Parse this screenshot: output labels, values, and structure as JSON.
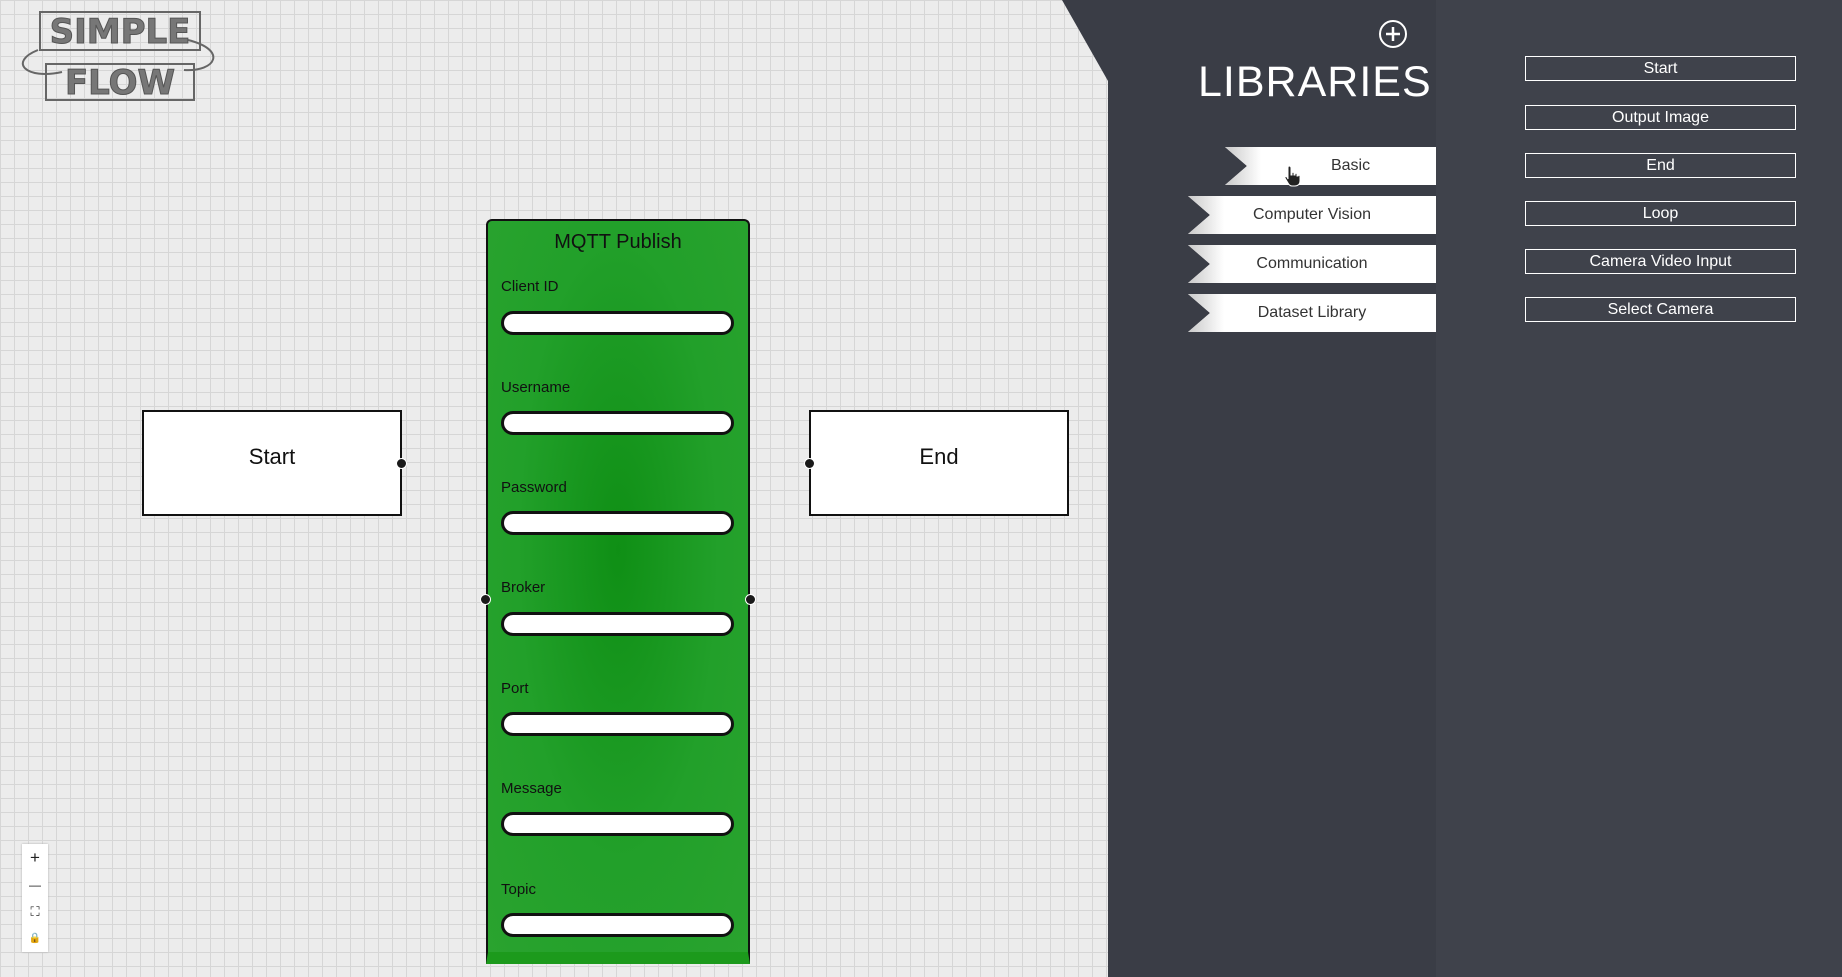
{
  "logo": {
    "line1": "SIMPLE",
    "line2": "FLOW"
  },
  "canvas": {
    "start_node": {
      "label": "Start"
    },
    "end_node": {
      "label": "End"
    },
    "mqtt_node": {
      "title": "MQTT Publish",
      "accent_color": "#22a02a",
      "fields": [
        {
          "label": "Client ID",
          "value": ""
        },
        {
          "label": "Username",
          "value": ""
        },
        {
          "label": "Password",
          "value": ""
        },
        {
          "label": "Broker",
          "value": ""
        },
        {
          "label": "Port",
          "value": ""
        },
        {
          "label": "Message",
          "value": ""
        },
        {
          "label": "Topic",
          "value": ""
        }
      ]
    },
    "zoom_controls": [
      {
        "icon": "plus-icon",
        "glyph": "+"
      },
      {
        "icon": "minus-icon",
        "glyph": "—"
      },
      {
        "icon": "fit-view-icon",
        "glyph": "⛶"
      },
      {
        "icon": "lock-icon",
        "glyph": "🔒"
      }
    ]
  },
  "sidebar": {
    "title": "LIBRARIES",
    "background_color": "#3a3d46",
    "add_icon": "plus-circle-icon",
    "tabs": [
      {
        "label": "Basic",
        "active": true
      },
      {
        "label": "Computer Vision",
        "active": false
      },
      {
        "label": "Communication",
        "active": false
      },
      {
        "label": "Dataset Library",
        "active": false
      }
    ],
    "library_items": [
      {
        "label": "Start"
      },
      {
        "label": "Output Image"
      },
      {
        "label": "End"
      },
      {
        "label": "Loop"
      },
      {
        "label": "Camera Video Input"
      },
      {
        "label": "Select Camera"
      }
    ]
  }
}
